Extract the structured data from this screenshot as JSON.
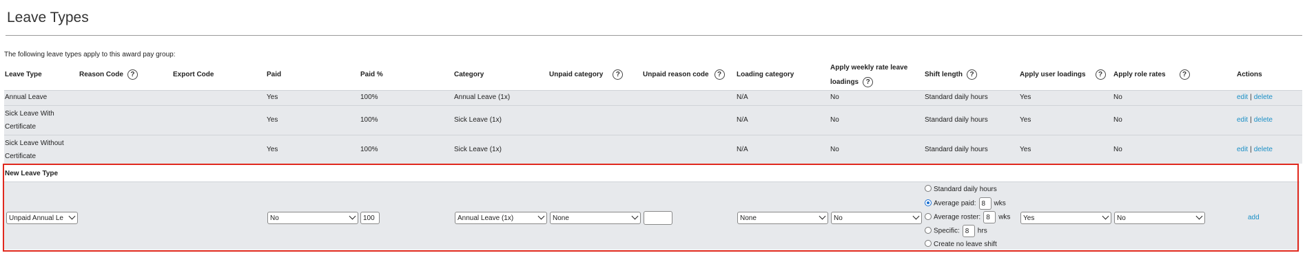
{
  "page": {
    "title": "Leave Types",
    "intro": "The following leave types apply to this award pay group:"
  },
  "columns": {
    "leave_type": "Leave Type",
    "reason_code": "Reason Code",
    "export_code": "Export Code",
    "paid": "Paid",
    "paid_pct": "Paid %",
    "category": "Category",
    "unpaid_category": "Unpaid category",
    "unpaid_reason_code": "Unpaid reason code",
    "loading_category": "Loading category",
    "apply_weekly_line1": "Apply weekly rate leave",
    "apply_weekly_line2": "loadings",
    "shift_length": "Shift length",
    "apply_user_loadings": "Apply user loadings",
    "apply_role_rates": "Apply role rates",
    "actions": "Actions",
    "help_glyph": "?"
  },
  "rows": [
    {
      "leave_type_line1": "Annual Leave",
      "leave_type_line2": "",
      "paid": "Yes",
      "paid_pct": "100%",
      "category": "Annual Leave (1x)",
      "loading_category": "N/A",
      "apply_weekly": "No",
      "shift_length": "Standard daily hours",
      "apply_user_loadings": "Yes",
      "apply_role_rates": "No"
    },
    {
      "leave_type_line1": "Sick Leave With",
      "leave_type_line2": "Certificate",
      "paid": "Yes",
      "paid_pct": "100%",
      "category": "Sick Leave (1x)",
      "loading_category": "N/A",
      "apply_weekly": "No",
      "shift_length": "Standard daily hours",
      "apply_user_loadings": "Yes",
      "apply_role_rates": "No"
    },
    {
      "leave_type_line1": "Sick Leave Without",
      "leave_type_line2": "Certificate",
      "paid": "Yes",
      "paid_pct": "100%",
      "category": "Sick Leave (1x)",
      "loading_category": "N/A",
      "apply_weekly": "No",
      "shift_length": "Standard daily hours",
      "apply_user_loadings": "Yes",
      "apply_role_rates": "No"
    }
  ],
  "actions": {
    "edit": "edit",
    "delete": "delete",
    "separator": "|",
    "add": "add"
  },
  "new_leave": {
    "heading": "New Leave Type",
    "leave_type_value": "Unpaid Annual Le",
    "paid_value": "No",
    "paid_pct_value": "100",
    "category_value": "Annual Leave (1x)",
    "unpaid_category_value": "None",
    "unpaid_reason_code_value": "",
    "loading_category_value": "None",
    "apply_weekly_value": "No",
    "apply_user_loadings_value": "Yes",
    "apply_role_rates_value": "No",
    "shift_options": {
      "standard": "Standard daily hours",
      "average_paid": "Average paid:",
      "average_paid_value": "8",
      "average_paid_unit": "wks",
      "average_roster": "Average roster:",
      "average_roster_value": "8",
      "average_roster_unit": "wks",
      "specific": "Specific:",
      "specific_value": "8",
      "specific_unit": "hrs",
      "no_shift": "Create no leave shift",
      "selected": "average_paid"
    }
  },
  "icons": {
    "help": "question-circle-icon",
    "dropdown": "chevron-down-icon"
  },
  "colors": {
    "link": "#1a8fc6",
    "highlight_border": "#e0281d",
    "row_bg": "#e7e9ec",
    "radio_selected": "#1a6fd0"
  }
}
